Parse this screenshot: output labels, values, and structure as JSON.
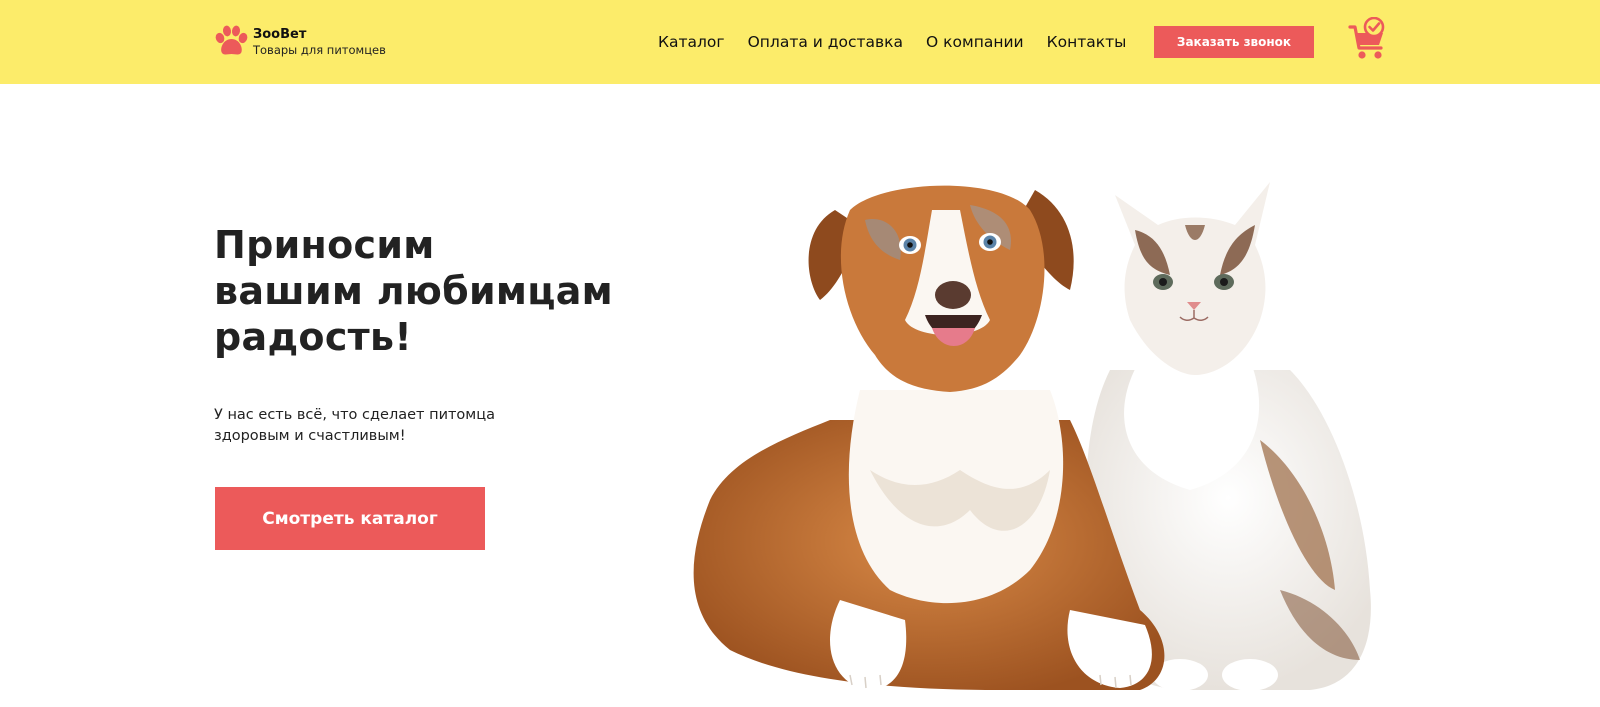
{
  "header": {
    "logo": {
      "icon": "paw-icon",
      "name": "ЗооВет",
      "tagline": "Товары для питомцев"
    },
    "nav": [
      {
        "label": "Каталог"
      },
      {
        "label": "Оплата и доставка"
      },
      {
        "label": "О компании"
      },
      {
        "label": "Контакты"
      }
    ],
    "call_button": "Заказать звонок",
    "cart_icon": "shopping-cart-check-icon"
  },
  "hero": {
    "title_lines": [
      "Приносим",
      "вашим любимцам",
      "радость!"
    ],
    "subtitle_lines": [
      "У нас есть всё, что сделает питомца",
      "здоровым и счастливым!"
    ],
    "cta": "Смотреть каталог",
    "image": "dog-and-cat-photo"
  },
  "colors": {
    "header_bg": "#fcec6a",
    "accent": "#ec5a5a",
    "text": "#222222"
  }
}
